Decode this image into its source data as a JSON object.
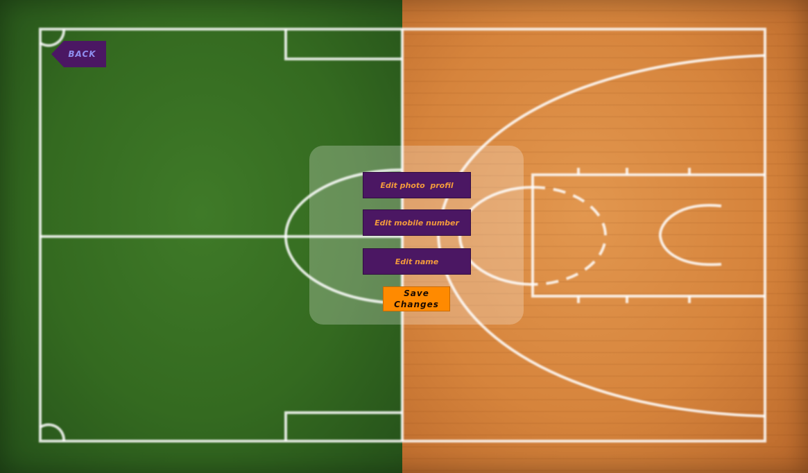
{
  "header": {
    "back_label": "BACK"
  },
  "profile_menu": {
    "edit_photo_label": "Edit photo  profil",
    "edit_mobile_label": "Edit mobile number",
    "edit_name_label": "Edit name",
    "save_label": "Save\nChanges"
  },
  "colors": {
    "grass": "#346a20",
    "wood": "#d6843c",
    "button_bg": "#4b1763",
    "button_text": "#f29a3c",
    "save_bg": "#ff8a00",
    "back_text": "#8f8ff0"
  }
}
